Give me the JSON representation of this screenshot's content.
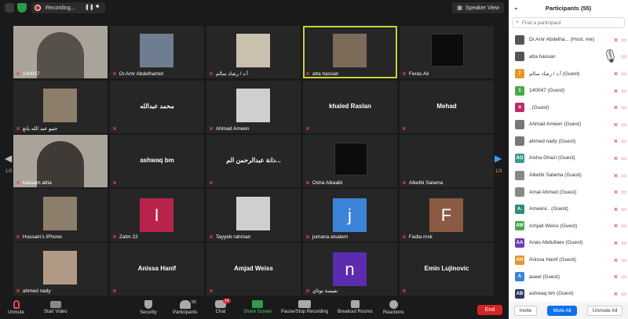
{
  "topbar": {
    "recording_label": "Recording...",
    "speaker_view_label": "Speaker View"
  },
  "grid": {
    "page_indicator_left": "1/3",
    "page_indicator_right": "1/3",
    "tiles": [
      {
        "label": "140047",
        "center": "",
        "kind": "photo"
      },
      {
        "label": "Dr.Amr Abdelhamid",
        "center": "",
        "kind": "photo"
      },
      {
        "label": "أ.د / رشاد سالم",
        "center": "",
        "kind": "photo"
      },
      {
        "label": "atta hassan",
        "center": "",
        "kind": "photo"
      },
      {
        "label": "Feras Ali",
        "center": "",
        "kind": "logo"
      },
      {
        "label": "جنيو عبد الله يانغ",
        "center": "",
        "kind": "photo"
      },
      {
        "label": "",
        "center": "محمد عبدالله",
        "kind": "name"
      },
      {
        "label": "Ahmad Ameen",
        "center": "",
        "kind": "photo"
      },
      {
        "label": "",
        "center": "khaled Raslan",
        "kind": "name"
      },
      {
        "label": "",
        "center": "Mehad",
        "kind": "name"
      },
      {
        "label": "bassam attia",
        "center": "",
        "kind": "photo"
      },
      {
        "label": "",
        "center": "ashwaq bm",
        "kind": "name"
      },
      {
        "label": "",
        "center": "دانة عبدالرحمن الم...",
        "kind": "name"
      },
      {
        "label": "Osha Alkaabi",
        "center": "",
        "kind": "logo"
      },
      {
        "label": "Alketbi Salama",
        "center": "",
        "kind": "blank"
      },
      {
        "label": "Hussain's iPhone",
        "center": "",
        "kind": "photo"
      },
      {
        "label": "Zatm 22",
        "center": "",
        "kind": "avatar",
        "letter": "I",
        "color": "#b8234a"
      },
      {
        "label": "Tayyeb rahman",
        "center": "",
        "kind": "photo"
      },
      {
        "label": "jumana alsalem",
        "center": "",
        "kind": "avatar",
        "letter": "j",
        "color": "#3b84d9"
      },
      {
        "label": "Fadia msk",
        "center": "",
        "kind": "avatar",
        "letter": "F",
        "color": "#8a5a43"
      },
      {
        "label": "ahmed nady",
        "center": "",
        "kind": "photo"
      },
      {
        "label": "",
        "center": "Anissa Hanif",
        "kind": "name"
      },
      {
        "label": "",
        "center": "Amjad Weiss",
        "kind": "name"
      },
      {
        "label": "نفيسة توثاي",
        "center": "",
        "kind": "avatar",
        "letter": "n",
        "color": "#5b2bb0"
      },
      {
        "label": "",
        "center": "Emin Lujinovic",
        "kind": "name"
      }
    ]
  },
  "toolbar": {
    "unmute": "Unmute",
    "start_video": "Start Video",
    "security": "Security",
    "participants": "Participants",
    "participants_count": "55",
    "chat": "Chat",
    "chat_badge": "14",
    "share_screen": "Share Screen",
    "pause_stop": "Pause/Stop Recording",
    "breakout": "Breakout Rooms",
    "reactions": "Reactions",
    "end": "End"
  },
  "panel": {
    "title": "Participants (55)",
    "search_placeholder": "Find a participant",
    "participants": [
      {
        "name": "Dr.Amr Abdelha... (Host, me)",
        "av": "photo",
        "color": "#555",
        "letter": ""
      },
      {
        "name": "atta hassan",
        "av": "photo",
        "color": "#555",
        "letter": ""
      },
      {
        "name": "أ.د / رشاد سالم (Guest)",
        "av": "letter",
        "color": "#e6962b",
        "letter": "أ"
      },
      {
        "name": "140047 (Guest)",
        "av": "letter",
        "color": "#4aa84a",
        "letter": "1"
      },
      {
        "name": ". (Guest)",
        "av": "letter",
        "color": "#c02a6b",
        "letter": "a"
      },
      {
        "name": "Ahmad Ameen (Guest)",
        "av": "photo",
        "color": "#777",
        "letter": ""
      },
      {
        "name": "ahmed nady (Guest)",
        "av": "photo",
        "color": "#777",
        "letter": ""
      },
      {
        "name": "Aisha Ghazi (Guest)",
        "av": "letter",
        "color": "#3d9a8a",
        "letter": "AG"
      },
      {
        "name": "Alketbi Salama (Guest)",
        "av": "photo",
        "color": "#888",
        "letter": ""
      },
      {
        "name": "Amal Ahmed (Guest)",
        "av": "photo",
        "color": "#888",
        "letter": ""
      },
      {
        "name": "Ameera . (Guest)",
        "av": "letter",
        "color": "#2e8b7a",
        "letter": "A."
      },
      {
        "name": "Amjad Weiss (Guest)",
        "av": "letter",
        "color": "#4aa84a",
        "letter": "AW"
      },
      {
        "name": "Anas Abdullaev (Guest)",
        "av": "letter",
        "color": "#6b3db5",
        "letter": "AA"
      },
      {
        "name": "Anissa Hanif (Guest)",
        "av": "letter",
        "color": "#e6962b",
        "letter": "AH"
      },
      {
        "name": "aseel (Guest)",
        "av": "letter",
        "color": "#3b84d9",
        "letter": "A"
      },
      {
        "name": "ashwaq bm (Guest)",
        "av": "letter",
        "color": "#2d3a66",
        "letter": "AB"
      }
    ],
    "invite": "Invite",
    "mute_all": "Mute All",
    "unmute_all": "Unmute All"
  }
}
